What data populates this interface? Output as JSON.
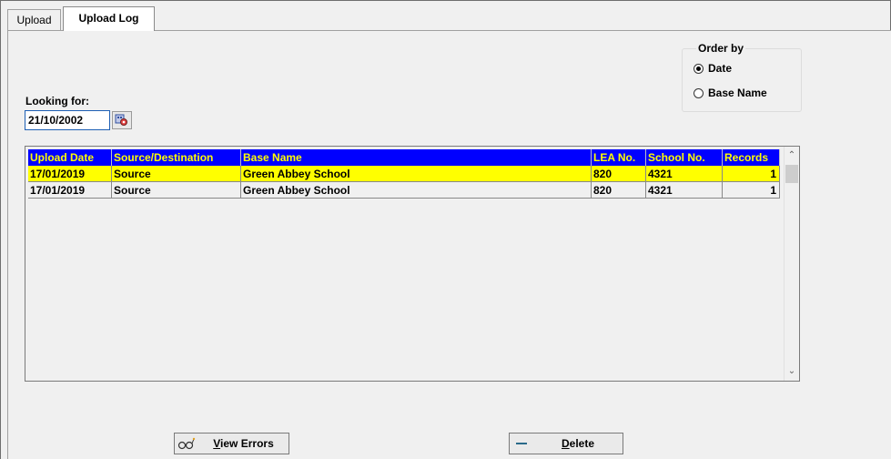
{
  "tabs": [
    {
      "label": "Upload"
    },
    {
      "label": "Upload Log"
    }
  ],
  "order_by": {
    "title": "Order by",
    "options": [
      {
        "label": "Date",
        "checked": true
      },
      {
        "label": "Base Name",
        "checked": false
      }
    ]
  },
  "search": {
    "label": "Looking for:",
    "value": "21/10/2002",
    "picker_icon": "calendar-lookup-icon"
  },
  "grid": {
    "columns": [
      "Upload Date",
      "Source/Destination",
      "Base Name",
      "LEA No.",
      "School No.",
      "Records"
    ],
    "rows": [
      {
        "upload_date": "17/01/2019",
        "source": "Source",
        "base_name": "Green Abbey School",
        "lea": "820",
        "school": "4321",
        "records": "1",
        "selected": true
      },
      {
        "upload_date": "17/01/2019",
        "source": "Source",
        "base_name": "Green Abbey School",
        "lea": "820",
        "school": "4321",
        "records": "1",
        "selected": false
      }
    ],
    "header_bg": "#0000ff",
    "header_fg": "#ffff00",
    "selected_bg": "#ffff00"
  },
  "buttons": {
    "view_errors": {
      "mnemonic": "V",
      "rest": "iew Errors",
      "icon": "glasses-icon"
    },
    "delete": {
      "mnemonic": "D",
      "rest": "elete",
      "icon": "minus-icon"
    }
  }
}
